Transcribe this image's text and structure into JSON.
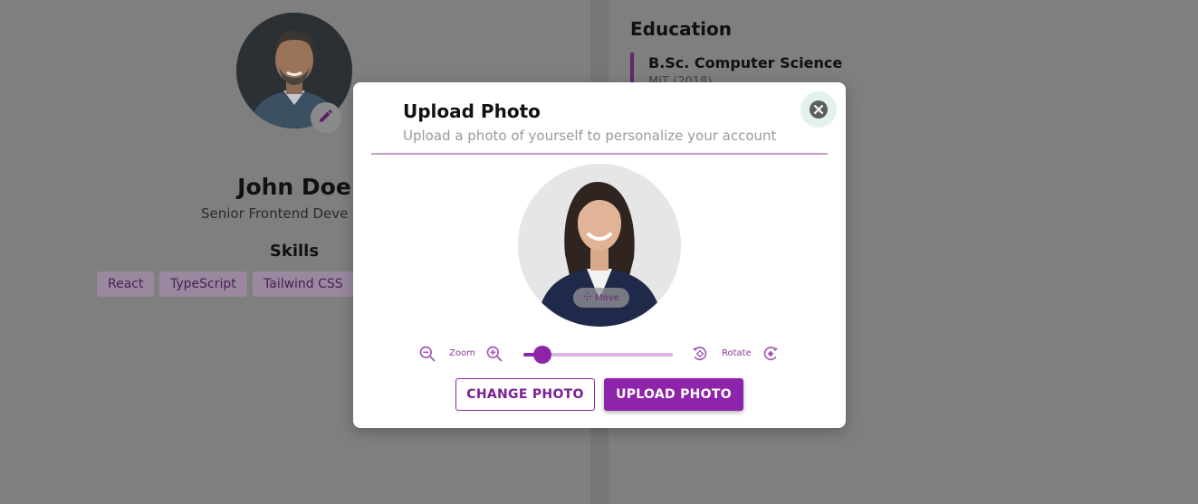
{
  "profile": {
    "name": "John Doe",
    "title": "Senior Frontend Deve",
    "skills_heading": "Skills",
    "skills": [
      "React",
      "TypeScript",
      "Tailwind CSS"
    ]
  },
  "education": {
    "heading": "Education",
    "items": [
      {
        "degree": "B.Sc. Computer Science",
        "school": "MIT (2018)"
      }
    ]
  },
  "modal": {
    "title": "Upload Photo",
    "subtitle": "Upload a photo of yourself to personalize your account",
    "move_label": "Move",
    "zoom_label": "Zoom",
    "rotate_label": "Rotate",
    "zoom_value": 0.13,
    "change_button": "CHANGE PHOTO",
    "upload_button": "UPLOAD PHOTO"
  },
  "colors": {
    "accent": "#8e24aa",
    "overlay": "#7f7f7f"
  },
  "icons": {
    "edit": "pencil-icon",
    "close": "close-icon",
    "zoom_out": "zoom-out-icon",
    "zoom_in": "zoom-in-icon",
    "rotate_left": "rotate-left-icon",
    "rotate_right": "rotate-right-icon",
    "move": "move-icon"
  }
}
